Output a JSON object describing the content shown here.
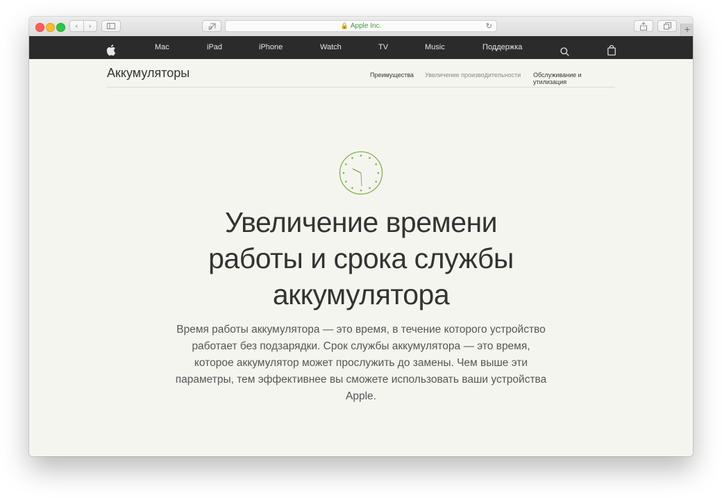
{
  "browser": {
    "address_site": "Apple Inc.",
    "lock_icon": "lock-icon",
    "new_tab_label": "+"
  },
  "nav": {
    "items": [
      "Mac",
      "iPad",
      "iPhone",
      "Watch",
      "TV",
      "Music",
      "Поддержка"
    ],
    "icons": [
      "apple-logo-icon",
      "search-icon",
      "bag-icon"
    ]
  },
  "local_nav": {
    "title": "Аккумуляторы",
    "links": [
      {
        "label": "Преимущества",
        "current": false
      },
      {
        "label": "Увеличение производительности",
        "current": true
      },
      {
        "label": "Обслуживание и утилизация",
        "current": false
      }
    ]
  },
  "hero": {
    "icon": "clock-icon",
    "accent_color": "#7fb247",
    "title_lines": [
      "Увеличение времени",
      "работы и срока службы",
      "аккумулятора"
    ],
    "text_lines": [
      "Время работы аккумулятора — это время, в течение которого устройство",
      "работает без подзарядки. Срок службы аккумулятора — это время,",
      "которое аккумулятор может прослужить до замены. Чем выше эти",
      "параметры, тем эффективнее вы сможете использовать ваши устройства",
      "Apple."
    ]
  }
}
